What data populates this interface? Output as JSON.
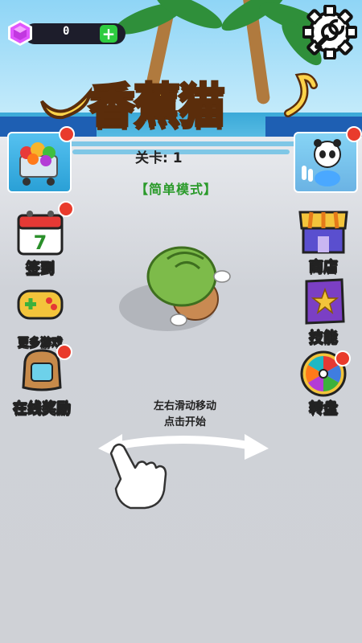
{
  "currency": {
    "gems": "0",
    "add_label": "+"
  },
  "title": "香蕉猫",
  "level_label": "关卡: 1",
  "mode_label": "【简单模式】",
  "left_menu": [
    {
      "label": "签到",
      "icon": "calendar-icon",
      "has_badge": true
    },
    {
      "label": "更多游戏",
      "icon": "gamepad-icon",
      "has_badge": false
    },
    {
      "label": "在线奖励",
      "icon": "backpack-icon",
      "has_badge": true
    }
  ],
  "right_menu": [
    {
      "label": "商店",
      "icon": "shop-icon",
      "has_badge": false
    },
    {
      "label": "技能",
      "icon": "spellbook-icon",
      "has_badge": false
    },
    {
      "label": "转盘",
      "icon": "wheel-icon",
      "has_badge": true
    }
  ],
  "hint": {
    "line1": "左右滑动移动",
    "line2": "点击开始"
  },
  "colors": {
    "badge": "#e93b2c",
    "mode_text": "#2a9a2a",
    "gem": "#e056fd",
    "title_fill": "#fcd34a"
  }
}
